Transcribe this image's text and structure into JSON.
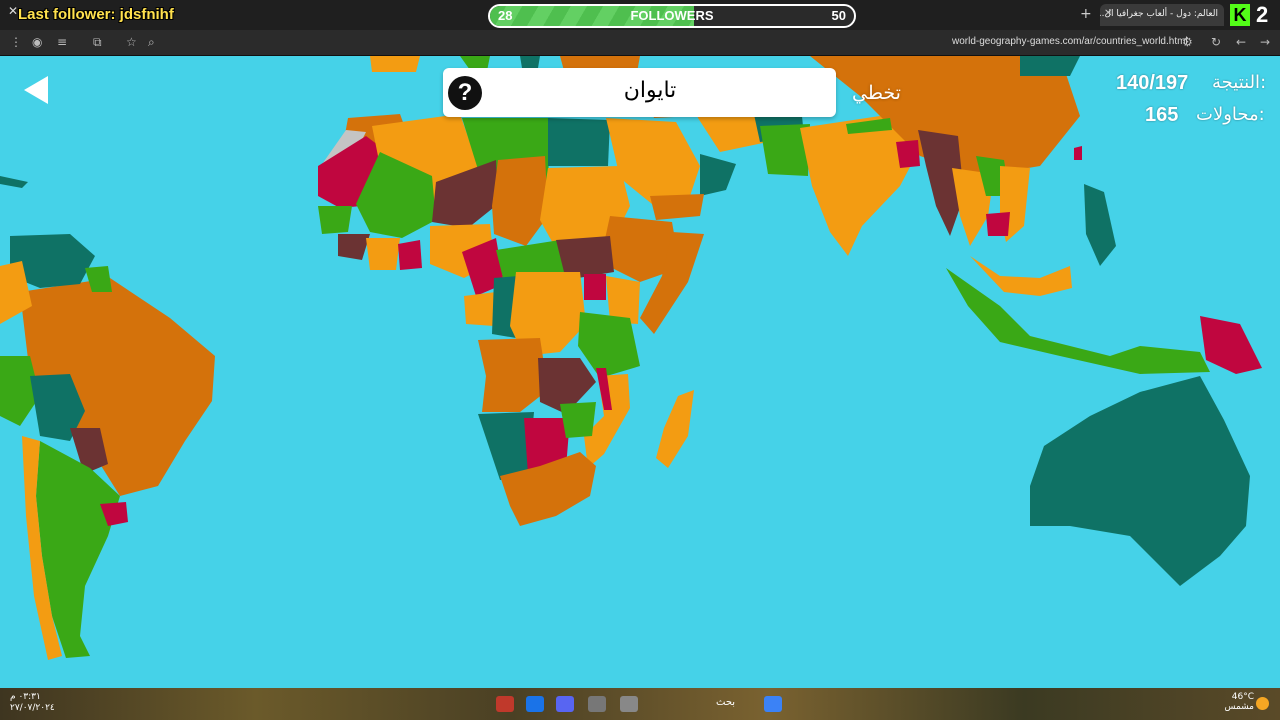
{
  "stream": {
    "last_follower": "Last follower: jdsfnihf",
    "followers_label": "FOLLOWERS",
    "followers_current": "28",
    "followers_goal": "50",
    "followers_progress": 0.56,
    "kick_count": "2"
  },
  "browser": {
    "tab_title": "العالم: دول - ألعاب جغرافيا ال...",
    "url": "world-geography-games.com/ar/countries_world.html"
  },
  "game": {
    "target_country": "تايوان",
    "help_glyph": "?",
    "skip_label": "تخطي",
    "score_label": "النتيجة:",
    "score_value": "140/197",
    "attempts_label": "محاولات:",
    "attempts_value": "165",
    "ocean_color": "#45d2e8",
    "country_colors": [
      "#f39c12",
      "#d4720b",
      "#6b3333",
      "#c0063f",
      "#3aa816",
      "#0f7265",
      "#c4c4c4"
    ]
  },
  "taskbar": {
    "search_label": "بحث",
    "weather_temp": "46°C",
    "weather_desc": "مشمس",
    "clock_time": "٠٣:٣١ م",
    "clock_date": "٢٧/٠٧/٢٠٢٤"
  }
}
